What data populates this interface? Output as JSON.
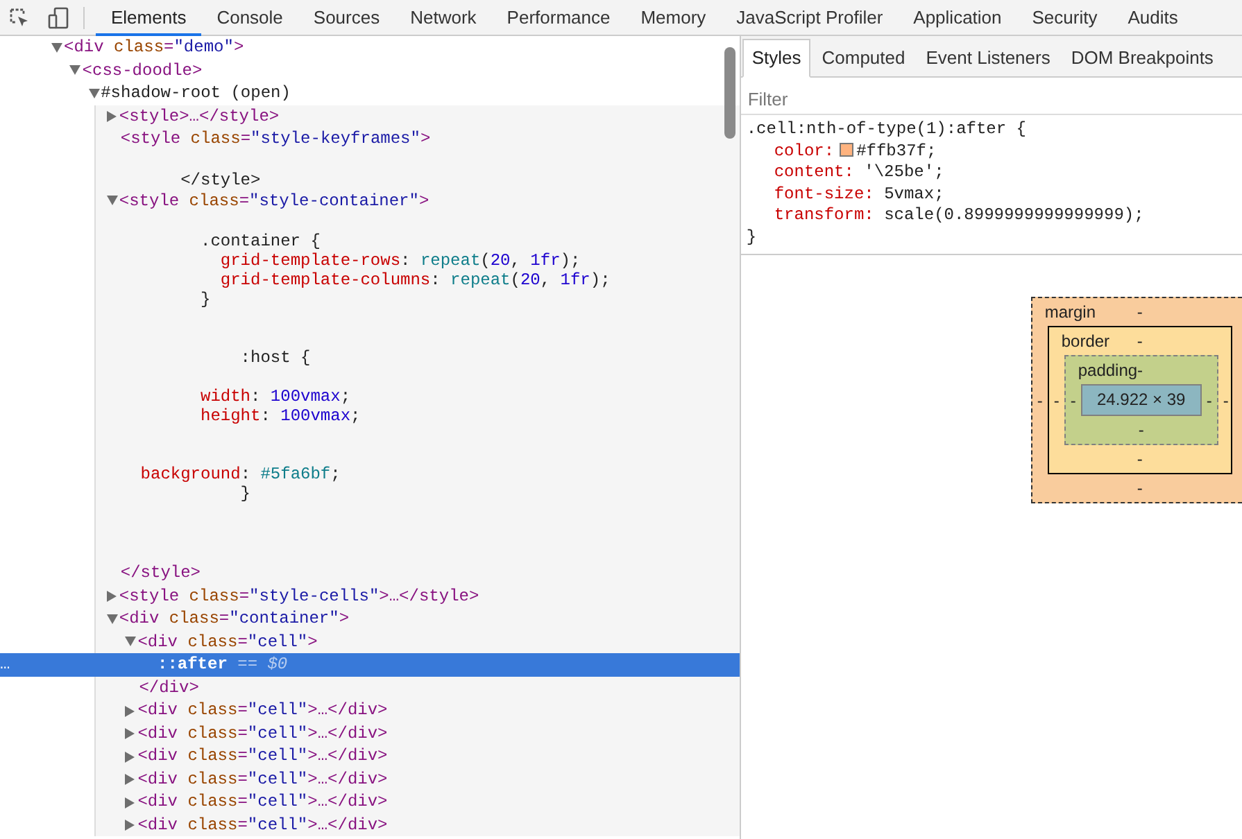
{
  "toolbar": {
    "tabs": [
      {
        "label": "Elements",
        "selected": true
      },
      {
        "label": "Console",
        "selected": false
      },
      {
        "label": "Sources",
        "selected": false
      },
      {
        "label": "Network",
        "selected": false
      },
      {
        "label": "Performance",
        "selected": false
      },
      {
        "label": "Memory",
        "selected": false
      },
      {
        "label": "JavaScript Profiler",
        "selected": false
      },
      {
        "label": "Application",
        "selected": false
      },
      {
        "label": "Security",
        "selected": false
      },
      {
        "label": "Audits",
        "selected": false
      }
    ]
  },
  "elements_tree": [
    {
      "kind": "element",
      "markup": "<div class=\"demo\">",
      "expanded": true,
      "selected": false,
      "children": [
        {
          "kind": "element",
          "markup": "<css-doodle>",
          "expanded": true,
          "selected": false,
          "children": [
            {
              "kind": "root",
              "markup": "#shadow-root (open)",
              "expanded": true,
              "selected": false,
              "children": [
                {
                  "kind": "element",
                  "markup": "<style>…</style>",
                  "expanded": false,
                  "selected": false
                },
                {
                  "kind": "element",
                  "markup": "<style class=\"style-keyframes\">",
                  "selected": false,
                  "children": [
                    {
                      "kind": "text",
                      "text": "\n      </style>"
                    }
                  ]
                },
                {
                  "kind": "element",
                  "markup": "<style class=\"style-container\">",
                  "expanded": true,
                  "selected": false,
                  "children": [
                    {
                      "kind": "text",
                      "text": "\n        .container {\n          grid-template-rows: repeat(20, 1fr);\n          grid-template-columns: repeat(20, 1fr);\n        }\n\n\n            :host {\n\n        width: 100vmax;\n        height: 100vmax;\n\n\n  background: #5fa6bf;\n            }\n\n\n\n"
                    }
                  ],
                  "closing": "</style>"
                },
                {
                  "kind": "element",
                  "markup": "<style class=\"style-cells\">…</style>",
                  "expanded": false,
                  "selected": false
                },
                {
                  "kind": "element",
                  "markup": "<div class=\"container\">",
                  "expanded": true,
                  "selected": false,
                  "children": [
                    {
                      "kind": "element",
                      "markup": "<div class=\"cell\">",
                      "expanded": true,
                      "selected": false,
                      "children": [
                        {
                          "kind": "pseudo",
                          "markup": "::after",
                          "suffix": "== $0",
                          "gutter": "…",
                          "selected": true
                        }
                      ],
                      "closing": "</div>"
                    },
                    {
                      "kind": "element",
                      "markup": "<div class=\"cell\">…</div>",
                      "expanded": false,
                      "selected": false
                    },
                    {
                      "kind": "element",
                      "markup": "<div class=\"cell\">…</div>",
                      "expanded": false,
                      "selected": false
                    },
                    {
                      "kind": "element",
                      "markup": "<div class=\"cell\">…</div>",
                      "expanded": false,
                      "selected": false
                    },
                    {
                      "kind": "element",
                      "markup": "<div class=\"cell\">…</div>",
                      "expanded": false,
                      "selected": false
                    },
                    {
                      "kind": "element",
                      "markup": "<div class=\"cell\">…</div>",
                      "expanded": false,
                      "selected": false
                    },
                    {
                      "kind": "element",
                      "markup": "<div class=\"cell\">…</div>",
                      "expanded": false,
                      "selected": false
                    }
                  ]
                }
              ]
            }
          ]
        }
      ]
    }
  ],
  "sidebar": {
    "tabs": [
      {
        "label": "Styles",
        "selected": true
      },
      {
        "label": "Computed",
        "selected": false
      },
      {
        "label": "Event Listeners",
        "selected": false
      },
      {
        "label": "DOM Breakpoints",
        "selected": false
      }
    ],
    "filter": {
      "placeholder": "Filter"
    },
    "rule": {
      "selector": ".cell:nth-of-type(1):after {",
      "declarations": [
        {
          "kind": "color",
          "property": "color:",
          "value": "#ffb37f;"
        },
        {
          "kind": "plain",
          "property": "content:",
          "value": "'\\25be';"
        },
        {
          "kind": "plain",
          "property": "font-size:",
          "value": "5vmax;"
        },
        {
          "kind": "plain",
          "property": "transform:",
          "value": "scale(0.8999999999999999);"
        }
      ],
      "closing": "}"
    },
    "box_model": {
      "margin": {
        "label": "margin",
        "top": "-",
        "left": "-",
        "bottom": "-"
      },
      "border": {
        "label": "border",
        "top": "-",
        "left": "-",
        "right": "-",
        "bottom": "-"
      },
      "padding": {
        "label": "padding-",
        "left": "-",
        "right": "-",
        "bottom": "-"
      },
      "content": "24.922 × 39"
    }
  }
}
